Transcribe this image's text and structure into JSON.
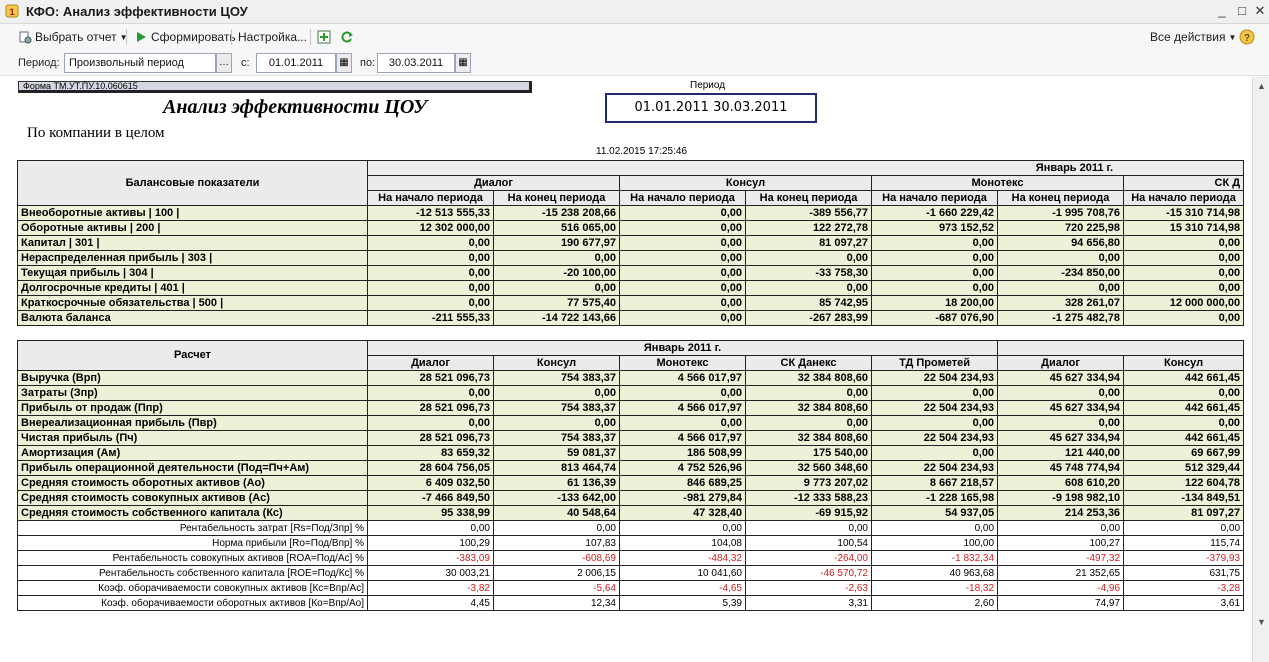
{
  "window": {
    "title": "КФО: Анализ эффективности ЦОУ"
  },
  "toolbar": {
    "select_report": "Выбрать отчет",
    "generate": "Сформировать",
    "settings": "Настройка...",
    "all_actions": "Все действия"
  },
  "params": {
    "period_label": "Период:",
    "period_value": "Произвольный период",
    "from_label": "с:",
    "from_value": "01.01.2011",
    "to_label": "по:",
    "to_value": "30.03.2011"
  },
  "report": {
    "form_code": "Форма ТМ.УТ.ПУ.10.060615",
    "period_caption": "Период",
    "period_value": "01.01.2011 30.03.2011",
    "title": "Анализ эффективности ЦОУ",
    "subtitle": "По компании в целом",
    "timestamp": "11.02.2015 17:25:46"
  },
  "balance": {
    "header": "Балансовые показатели",
    "month": "Январь 2011 г.",
    "companies": [
      "Диалог",
      "Консул",
      "Монотекс",
      "СК Д"
    ],
    "subcols": [
      "На начало периода",
      "На конец периода",
      "На начало периода",
      "На конец периода",
      "На начало периода",
      "На конец периода",
      "На начало периода"
    ],
    "rows": [
      {
        "label": "Внеоборотные активы | 100 |",
        "values": [
          "-12 513 555,33",
          "-15 238 208,66",
          "0,00",
          "-389 556,77",
          "-1 660 229,42",
          "-1 995 708,76",
          "-15 310 714,98"
        ]
      },
      {
        "label": "Оборотные активы | 200 |",
        "values": [
          "12 302 000,00",
          "516 065,00",
          "0,00",
          "122 272,78",
          "973 152,52",
          "720 225,98",
          "15 310 714,98"
        ]
      },
      {
        "label": "Капитал | 301 |",
        "values": [
          "0,00",
          "190 677,97",
          "0,00",
          "81 097,27",
          "0,00",
          "94 656,80",
          "0,00"
        ]
      },
      {
        "label": "Нераспределенная прибыль | 303 |",
        "values": [
          "0,00",
          "0,00",
          "0,00",
          "0,00",
          "0,00",
          "0,00",
          "0,00"
        ]
      },
      {
        "label": "Текущая прибыль | 304 |",
        "values": [
          "0,00",
          "-20 100,00",
          "0,00",
          "-33 758,30",
          "0,00",
          "-234 850,00",
          "0,00"
        ]
      },
      {
        "label": "Долгосрочные кредиты | 401 |",
        "values": [
          "0,00",
          "0,00",
          "0,00",
          "0,00",
          "0,00",
          "0,00",
          "0,00"
        ]
      },
      {
        "label": "Краткосрочные обязательства | 500 |",
        "values": [
          "0,00",
          "77 575,40",
          "0,00",
          "85 742,95",
          "18 200,00",
          "328 261,07",
          "12 000 000,00"
        ]
      },
      {
        "label": "Валюта баланса",
        "values": [
          "-211 555,33",
          "-14 722 143,66",
          "0,00",
          "-267 283,99",
          "-687 076,90",
          "-1 275 482,78",
          "0,00"
        ]
      }
    ]
  },
  "calc": {
    "header": "Расчет",
    "month": "Январь 2011 г.",
    "companies": [
      "Диалог",
      "Консул",
      "Монотекс",
      "СК Данекс",
      "ТД Прометей",
      "Диалог",
      "Консул"
    ],
    "rows": [
      {
        "label": "Выручка (Врп)",
        "values": [
          "28 521 096,73",
          "754 383,37",
          "4 566 017,97",
          "32 384 808,60",
          "22 504 234,93",
          "45 627 334,94",
          "442 661,45"
        ]
      },
      {
        "label": "Затраты (Зпр)",
        "values": [
          "0,00",
          "0,00",
          "0,00",
          "0,00",
          "0,00",
          "0,00",
          "0,00"
        ]
      },
      {
        "label": "Прибыль от продаж (Ппр)",
        "values": [
          "28 521 096,73",
          "754 383,37",
          "4 566 017,97",
          "32 384 808,60",
          "22 504 234,93",
          "45 627 334,94",
          "442 661,45"
        ]
      },
      {
        "label": "Внереализационная прибыль (Пвр)",
        "values": [
          "0,00",
          "0,00",
          "0,00",
          "0,00",
          "0,00",
          "0,00",
          "0,00"
        ]
      },
      {
        "label": "Чистая прибыль (Пч)",
        "values": [
          "28 521 096,73",
          "754 383,37",
          "4 566 017,97",
          "32 384 808,60",
          "22 504 234,93",
          "45 627 334,94",
          "442 661,45"
        ]
      },
      {
        "label": "Амортизация (Ам)",
        "values": [
          "83 659,32",
          "59 081,37",
          "186 508,99",
          "175 540,00",
          "0,00",
          "121 440,00",
          "69 667,99"
        ]
      },
      {
        "label": "Прибыль операционной деятельности (Под=Пч+Ам)",
        "values": [
          "28 604 756,05",
          "813 464,74",
          "4 752 526,96",
          "32 560 348,60",
          "22 504 234,93",
          "45 748 774,94",
          "512 329,44"
        ]
      },
      {
        "label": "Средняя стоимость оборотных активов (Ао)",
        "values": [
          "6 409 032,50",
          "61 136,39",
          "846 689,25",
          "9 773 207,02",
          "8 667 218,57",
          "608 610,20",
          "122 604,78"
        ]
      },
      {
        "label": "Средняя стоимость совокупных активов (Ас)",
        "values": [
          "-7 466 849,50",
          "-133 642,00",
          "-981 279,84",
          "-12 333 588,23",
          "-1 228 165,98",
          "-9 198 982,10",
          "-134 849,51"
        ]
      },
      {
        "label": "Средняя стоимость собственного капитала (Кс)",
        "values": [
          "95 338,99",
          "40 548,64",
          "47 328,40",
          "-69 915,92",
          "54 937,05",
          "214 253,36",
          "81 097,27"
        ]
      }
    ],
    "ratios": [
      {
        "label": "Рентабельность затрат [Rs=Под/Зпр] %",
        "values": [
          "0,00",
          "0,00",
          "0,00",
          "0,00",
          "0,00",
          "0,00",
          "0,00"
        ],
        "neg": [
          false,
          false,
          false,
          false,
          false,
          false,
          false
        ]
      },
      {
        "label": "Норма прибыли [Ro=Под/Впр] %",
        "values": [
          "100,29",
          "107,83",
          "104,08",
          "100,54",
          "100,00",
          "100,27",
          "115,74"
        ],
        "neg": [
          false,
          false,
          false,
          false,
          false,
          false,
          false
        ]
      },
      {
        "label": "Рентабельность совокупных активов [ROA=Под/Ас] %",
        "values": [
          "-383,09",
          "-608,69",
          "-484,32",
          "-264,00",
          "-1 832,34",
          "-497,32",
          "-379,93"
        ],
        "neg": [
          true,
          true,
          true,
          true,
          true,
          true,
          true
        ]
      },
      {
        "label": "Рентабельность собственного капитала [ROE=Под/Кс] %",
        "values": [
          "30 003,21",
          "2 006,15",
          "10 041,60",
          "-46 570,72",
          "40 963,68",
          "21 352,65",
          "631,75"
        ],
        "neg": [
          false,
          false,
          false,
          true,
          false,
          false,
          false
        ]
      },
      {
        "label": "Коэф. оборачиваемости совокупных активов [Кс=Впр/Ас]",
        "values": [
          "-3,82",
          "-5,64",
          "-4,65",
          "-2,63",
          "-18,32",
          "-4,96",
          "-3,28"
        ],
        "neg": [
          true,
          true,
          true,
          true,
          true,
          true,
          true
        ]
      },
      {
        "label": "Коэф. оборачиваемости оборотных активов [Ко=Впр/Ао]",
        "values": [
          "4,45",
          "12,34",
          "5,39",
          "3,31",
          "2,60",
          "74,97",
          "3,61"
        ],
        "neg": [
          false,
          false,
          false,
          false,
          false,
          false,
          false
        ]
      }
    ]
  }
}
